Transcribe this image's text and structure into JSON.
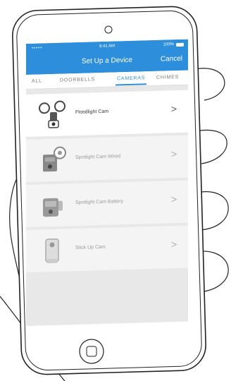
{
  "status": {
    "dots": "•••••",
    "time": "9:41 AM",
    "battery": "100%"
  },
  "nav": {
    "title": "Set Up a Device",
    "cancel_label": "Cancel"
  },
  "tabs": [
    {
      "label": "ALL",
      "active": false
    },
    {
      "label": "DOORBELLS",
      "active": false
    },
    {
      "label": "CAMERAS",
      "active": true
    },
    {
      "label": "CHIMES",
      "active": false
    }
  ],
  "devices": [
    {
      "name": "Floodlight Cam",
      "icon": "floodlight-cam-icon",
      "enabled": true
    },
    {
      "name": "Spotlight Cam Wired",
      "icon": "spotlight-cam-wired-icon",
      "enabled": false
    },
    {
      "name": "Spotlight Cam Battery",
      "icon": "spotlight-cam-battery-icon",
      "enabled": false
    },
    {
      "name": "Stick Up Cam",
      "icon": "stick-up-cam-icon",
      "enabled": false
    }
  ],
  "chevron_glyph": ">",
  "colors": {
    "accent": "#2d8fdc",
    "header_text": "#ffffff",
    "background": "#e8e8e8"
  }
}
